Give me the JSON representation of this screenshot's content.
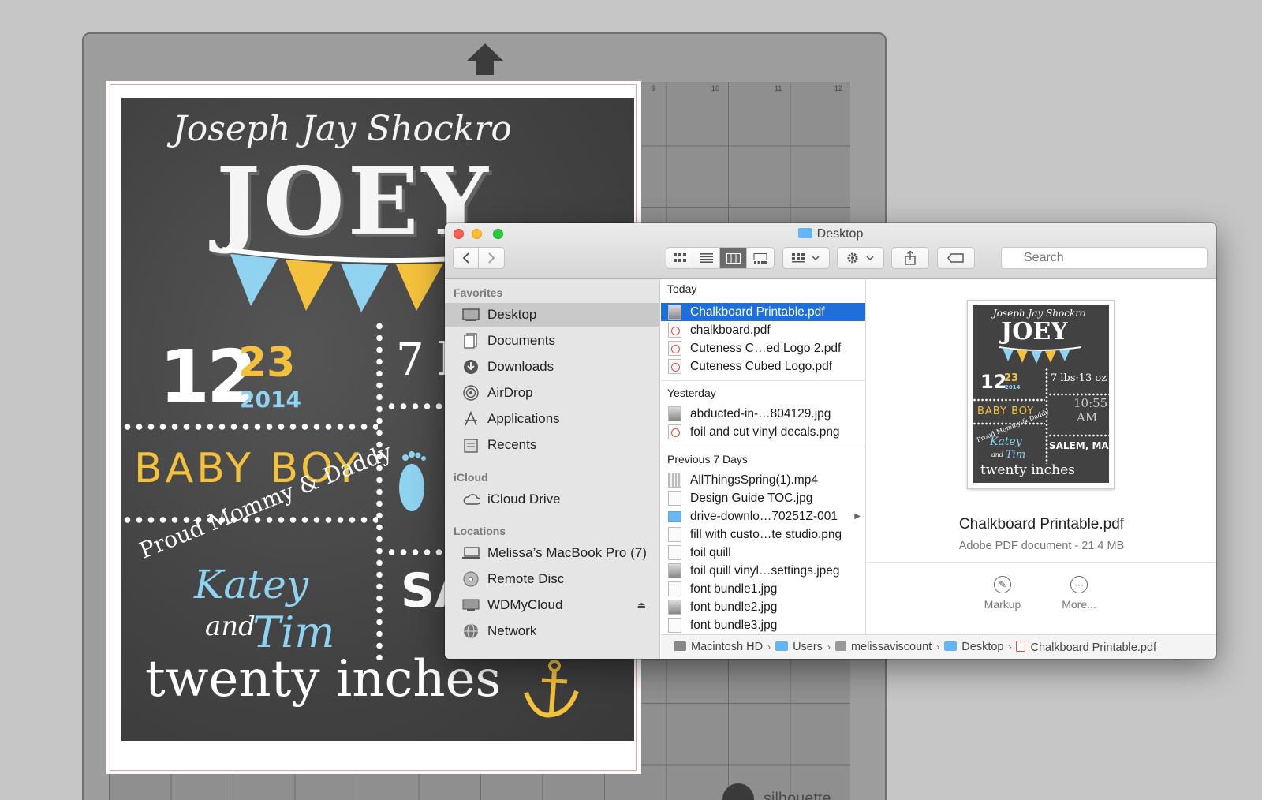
{
  "mat": {
    "ruler": [
      "9",
      "10",
      "11",
      "12"
    ],
    "brand": "silhouette"
  },
  "chalkboard": {
    "full_name": "Joseph Jay Shockro",
    "nickname": "JOEY",
    "date_month": "12",
    "date_day": "23",
    "date_year": "2014",
    "weight_partial": "7 l",
    "baby_boy": "BABY BOY",
    "proud": "Proud Mommy & Daddy",
    "mom": "Katey",
    "and": "and",
    "dad": "Tim",
    "length": "twenty inches",
    "city_partial": "SAL"
  },
  "finder": {
    "title": "Desktop",
    "search_placeholder": "Search",
    "sidebar": {
      "favorites_header": "Favorites",
      "favorites": [
        "Desktop",
        "Documents",
        "Downloads",
        "AirDrop",
        "Applications",
        "Recents"
      ],
      "icloud_header": "iCloud",
      "icloud": [
        "iCloud Drive"
      ],
      "locations_header": "Locations",
      "locations": [
        "Melissa’s MacBook Pro (7)",
        "Remote Disc",
        "WDMyCloud",
        "Network"
      ]
    },
    "files": {
      "today_header": "Today",
      "today": [
        "Chalkboard Printable.pdf",
        "chalkboard.pdf",
        "Cuteness  C…ed Logo 2.pdf",
        "Cuteness  Cubed Logo.pdf"
      ],
      "yesterday_header": "Yesterday",
      "yesterday": [
        "abducted-in-…804129.jpg",
        "foil and cut vinyl decals.png"
      ],
      "prev7_header": "Previous 7 Days",
      "prev7": [
        "AllThingsSpring(1).mp4",
        "Design Guide TOC.jpg",
        "drive-downlo…70251Z-001",
        "fill with custo…te studio.png",
        "foil quill",
        "foil quill vinyl…settings.jpeg",
        "font bundle1.jpg",
        "font bundle2.jpg",
        "font bundle3.jpg"
      ]
    },
    "preview": {
      "name": "Chalkboard Printable.pdf",
      "kind": "Adobe PDF document - 21.4 MB",
      "thumb_name": "Joseph Jay Shockro",
      "thumb_joey": "JOEY",
      "thumb_date": "12",
      "thumb_day": "23",
      "thumb_year": "2014",
      "thumb_weight": "7 lbs·13 oz",
      "thumb_babyboy": "BABY BOY",
      "thumb_time": "10:55",
      "thumb_ampm": "AM",
      "thumb_proud": "Proud Mommy & Daddy",
      "thumb_katey": "Katey",
      "thumb_and": "and",
      "thumb_tim": "Tim",
      "thumb_city": "SALEM, MASS",
      "thumb_inches": "twenty inches",
      "markup_label": "Markup",
      "more_label": "More..."
    },
    "pathbar": [
      "Macintosh HD",
      "Users",
      "melissaviscount",
      "Desktop",
      "Chalkboard Printable.pdf"
    ]
  },
  "colors": {
    "selection": "#1e6fd9",
    "chalk_yellow": "#f4c13d",
    "chalk_blue": "#8fd3f1"
  }
}
